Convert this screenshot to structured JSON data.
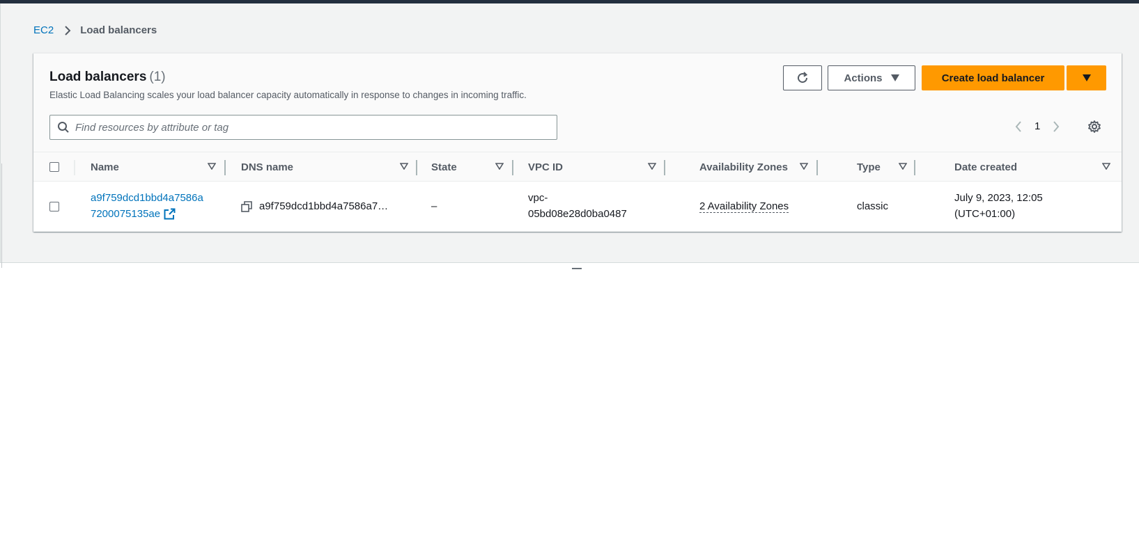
{
  "breadcrumb": {
    "parent": "EC2",
    "current": "Load balancers"
  },
  "header": {
    "title": "Load balancers",
    "count": "(1)",
    "description": "Elastic Load Balancing scales your load balancer capacity automatically in response to changes in incoming traffic."
  },
  "toolbar": {
    "actions_label": "Actions",
    "create_label": "Create load balancer"
  },
  "search": {
    "placeholder": "Find resources by attribute or tag"
  },
  "pagination": {
    "current_page": "1"
  },
  "table": {
    "columns": [
      "Name",
      "DNS name",
      "State",
      "VPC ID",
      "Availability Zones",
      "Type",
      "Date created"
    ],
    "rows": [
      {
        "name_line1": "a9f759dcd1bbd4a7586a",
        "name_line2": "7200075135ae",
        "dns_name": "a9f759dcd1bbd4a7586a7…",
        "state": "–",
        "vpc_line1": "vpc-",
        "vpc_line2": "05bd08e28d0ba0487",
        "availability_zones": "2 Availability Zones",
        "type": "classic",
        "date_line1": "July 9, 2023, 12:05",
        "date_line2": "(UTC+01:00)"
      }
    ]
  },
  "colors": {
    "primary_button": "#ff9900",
    "link": "#0073bb",
    "top_nav": "#232f3e"
  }
}
